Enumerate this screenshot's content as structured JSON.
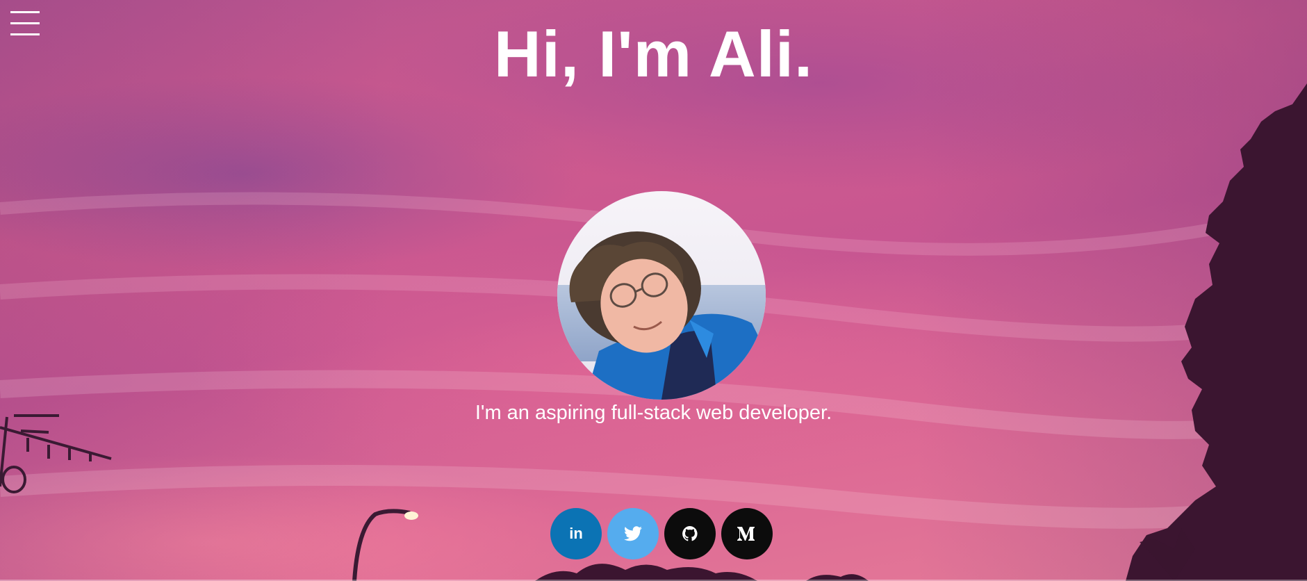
{
  "header": {
    "menu_icon": "hamburger-icon",
    "title": "Hi, I'm Ali."
  },
  "profile": {
    "tagline": "I'm an aspiring full-stack web developer."
  },
  "social": [
    {
      "name": "LinkedIn",
      "glyph": "in",
      "icon": "linkedin-icon",
      "color": "#0b73b4"
    },
    {
      "name": "Twitter",
      "icon": "twitter-icon",
      "color": "#55acee"
    },
    {
      "name": "GitHub",
      "icon": "github-icon",
      "color": "#0c0c0c"
    },
    {
      "name": "Medium",
      "icon": "medium-icon",
      "color": "#0c0c0c"
    }
  ],
  "colors": {
    "text": "#ffffff",
    "sky_top": "#b5538f",
    "sky_bottom": "#e57b98",
    "silhouette": "#3b1530"
  }
}
